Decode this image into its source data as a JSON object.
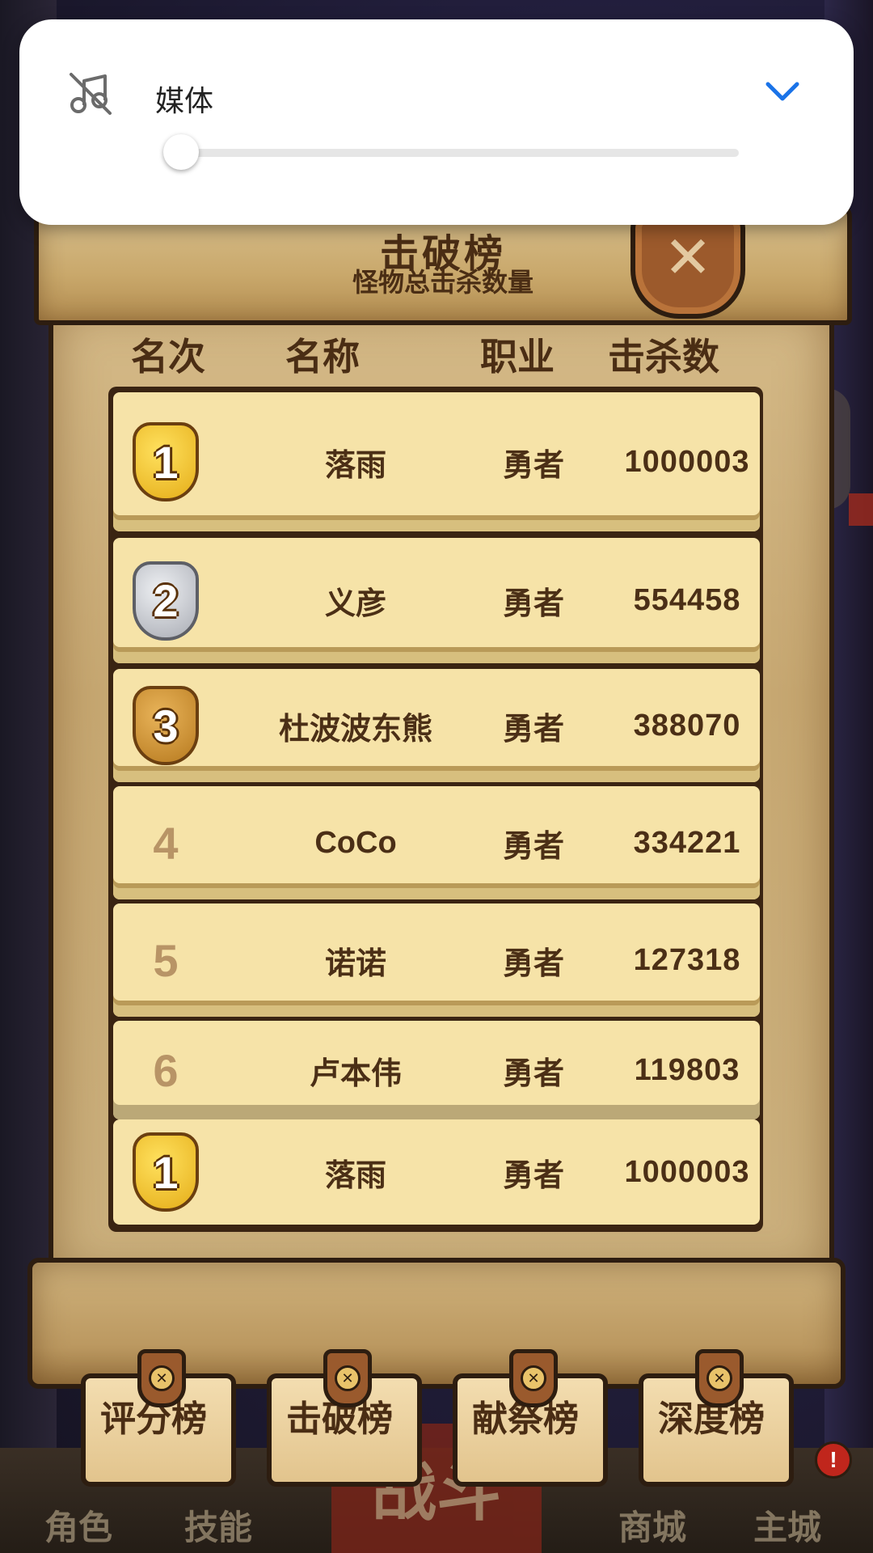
{
  "volume_panel": {
    "label": "媒体",
    "level": 0,
    "icon": "music-muted-icon",
    "expand_icon": "chevron-down-icon",
    "accent_color": "#1a73e8"
  },
  "leaderboard": {
    "title": "击破榜",
    "subtitle": "怪物总击杀数量",
    "columns": {
      "rank": "名次",
      "name": "名称",
      "job": "职业",
      "kills": "击杀数"
    },
    "rows": [
      {
        "rank": "1",
        "medal": "gold",
        "name": "落雨",
        "job": "勇者",
        "kills": "1000003"
      },
      {
        "rank": "2",
        "medal": "silver",
        "name": "义彦",
        "job": "勇者",
        "kills": "554458"
      },
      {
        "rank": "3",
        "medal": "bronze",
        "name": "杜波波东熊",
        "job": "勇者",
        "kills": "388070"
      },
      {
        "rank": "4",
        "medal": "",
        "name": "CoCo",
        "job": "勇者",
        "kills": "334221"
      },
      {
        "rank": "5",
        "medal": "",
        "name": "诺诺",
        "job": "勇者",
        "kills": "127318"
      },
      {
        "rank": "6",
        "medal": "",
        "name": "卢本伟",
        "job": "勇者",
        "kills": "119803"
      }
    ],
    "self_row": {
      "rank": "1",
      "medal": "gold",
      "name": "落雨",
      "job": "勇者",
      "kills": "1000003"
    }
  },
  "board_tabs": [
    "评分榜",
    "击破榜",
    "献祭榜",
    "深度榜"
  ],
  "game_nav": {
    "items": [
      "角色",
      "技能",
      "战斗",
      "商城",
      "主城"
    ],
    "alert": "!"
  }
}
